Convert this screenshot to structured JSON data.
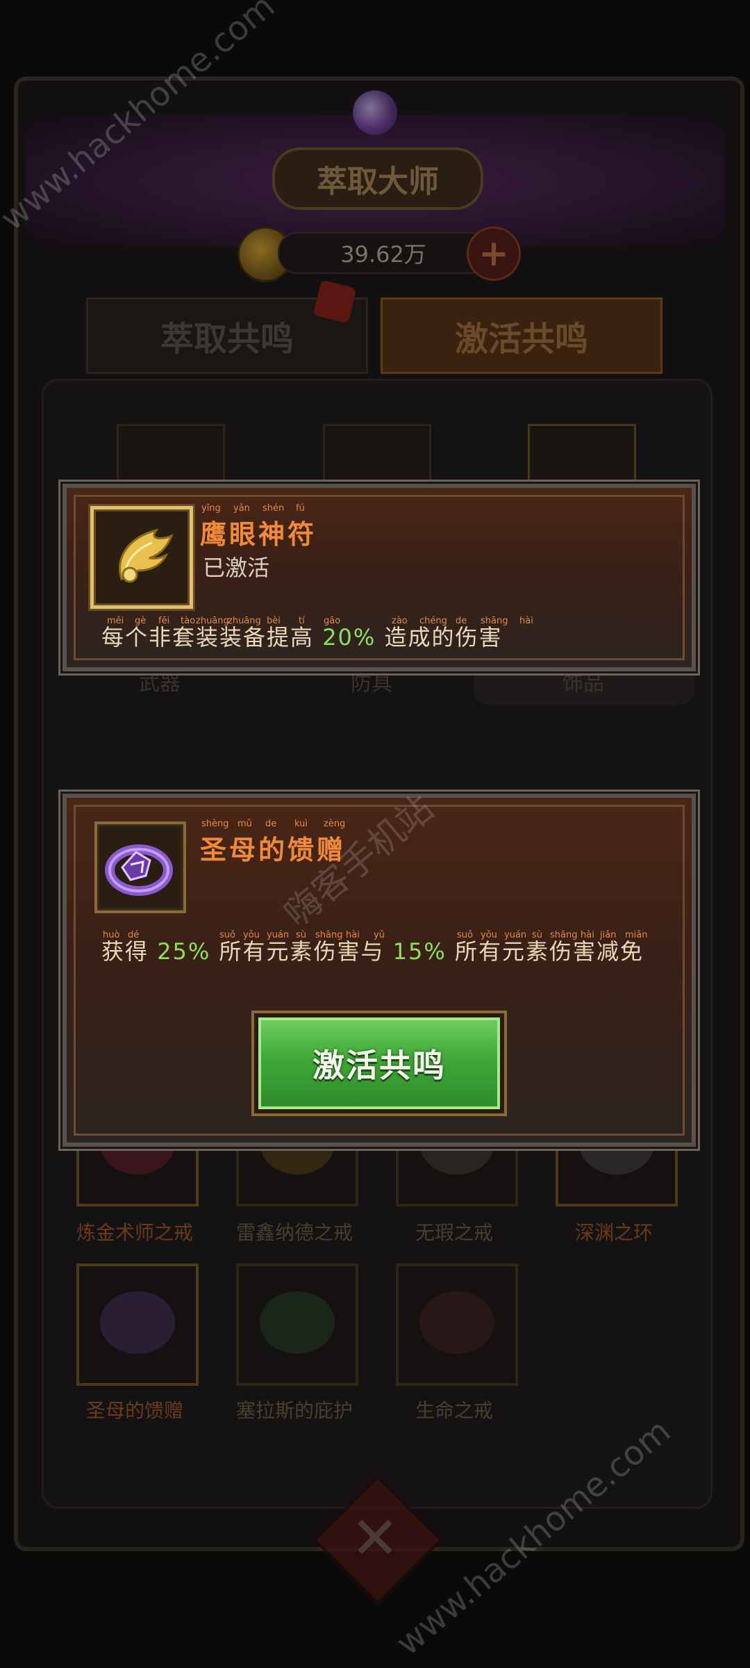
{
  "header": {
    "title": "萃取大师",
    "currency_amount": "39.62万"
  },
  "tabs": [
    {
      "label": "萃取共鸣",
      "active": false
    },
    {
      "label": "激活共鸣",
      "active": true
    }
  ],
  "category_tabs": [
    "武器",
    "防具",
    "饰品"
  ],
  "grid_items": [
    {
      "name": "炼金术师之戒",
      "label_color": "orange"
    },
    {
      "name": "雷鑫纳德之戒",
      "label_color": "dim"
    },
    {
      "name": "无瑕之戒",
      "label_color": "dim"
    },
    {
      "name": "深渊之环",
      "label_color": "orange"
    },
    {
      "name": "圣母的馈赠",
      "label_color": "orange"
    },
    {
      "name": "塞拉斯的庇护",
      "label_color": "dim"
    },
    {
      "name": "生命之戒",
      "label_color": "dim"
    }
  ],
  "popup_top": {
    "icon": "golden-wing-amulet-icon",
    "name": "鹰眼神符",
    "name_pinyin": [
      "yīng",
      "yǎn",
      "shén",
      "fú"
    ],
    "status": "已激活",
    "desc_before": "每个非套装装备提高",
    "desc_pct": "20%",
    "desc_after": "造成的伤害",
    "desc_pinyin_before": [
      "měi",
      "gè",
      "fēi",
      "tào",
      "zhuāng",
      "zhuāng",
      "bèi",
      "tí",
      "gāo"
    ],
    "desc_pinyin_after": [
      "zào",
      "chéng",
      "de",
      "shāng",
      "hài"
    ]
  },
  "popup_bottom": {
    "icon": "purple-ring-icon",
    "name": "圣母的馈赠",
    "name_pinyin": [
      "shèng",
      "mǔ",
      "de",
      "kuì",
      "zèng"
    ],
    "desc_1": "获得",
    "desc_pct_1": "25%",
    "desc_2": "所有元素伤害与",
    "desc_pct_2": "15%",
    "desc_3": "所有元素伤害减免",
    "desc_pinyin_1": [
      "huò",
      "dé"
    ],
    "desc_pinyin_2": [
      "suǒ",
      "yǒu",
      "yuán",
      "sù",
      "shāng",
      "hài",
      "yǔ"
    ],
    "desc_pinyin_3": [
      "suǒ",
      "yǒu",
      "yuán",
      "sù",
      "shāng",
      "hài",
      "jiǎn",
      "miǎn"
    ],
    "button_label": "激活共鸣"
  },
  "watermarks": [
    "www.hackhome.com",
    "www.hackhome.com",
    "嗨客手机站"
  ],
  "colors": {
    "accent_orange": "#f08a3a",
    "percent_green": "#8ee05a",
    "button_green": "#3fa838"
  }
}
